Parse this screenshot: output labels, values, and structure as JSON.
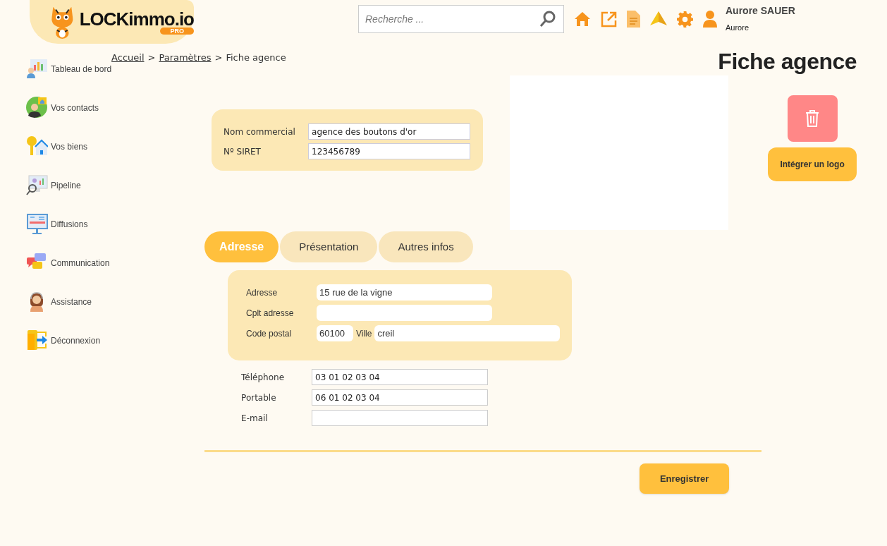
{
  "header": {
    "logo": {
      "name": "LOCKimmo.io",
      "badge": "PRO"
    },
    "search": {
      "placeholder": "Recherche ..."
    },
    "user": {
      "name": "Aurore SAUER",
      "subtitle": "Aurore"
    }
  },
  "sidebar": {
    "items": [
      {
        "label": "Tableau de bord"
      },
      {
        "label": "Vos contacts"
      },
      {
        "label": "Vos biens"
      },
      {
        "label": "Pipeline"
      },
      {
        "label": "Diffusions"
      },
      {
        "label": "Communication"
      },
      {
        "label": "Assistance"
      },
      {
        "label": "Déconnexion"
      }
    ]
  },
  "breadcrumb": [
    {
      "label": "Accueil",
      "link": true
    },
    {
      "label": "Paramètres",
      "link": true
    },
    {
      "label": "Fiche agence",
      "link": false
    }
  ],
  "breadcrumb_separator": ">",
  "title": "Fiche agence",
  "identity": [
    {
      "label": "Nom commercial",
      "value": "agence des boutons d'or"
    },
    {
      "label": "Nº SIRET",
      "value": "123456789"
    }
  ],
  "logo_actions": {
    "integrate_label": "Intégrer un logo"
  },
  "tabs": [
    {
      "label": "Adresse",
      "selected": true
    },
    {
      "label": "Présentation",
      "selected": false
    },
    {
      "label": "Autres infos",
      "selected": false
    }
  ],
  "address": {
    "street": {
      "label": "Adresse",
      "value": "15 rue de la vigne"
    },
    "complement": {
      "label": "Cplt adresse"
    },
    "postal_code": {
      "label": "Code postal",
      "value": "60100"
    },
    "city": {
      "label": "Ville",
      "value": "creil"
    }
  },
  "contacts": [
    {
      "label": "Téléphone",
      "value": "03 01 02 03 04"
    },
    {
      "label": "Portable",
      "value": "06 01 02 03 04"
    },
    {
      "label": "E-mail"
    }
  ],
  "save_label": "Enregistrer"
}
